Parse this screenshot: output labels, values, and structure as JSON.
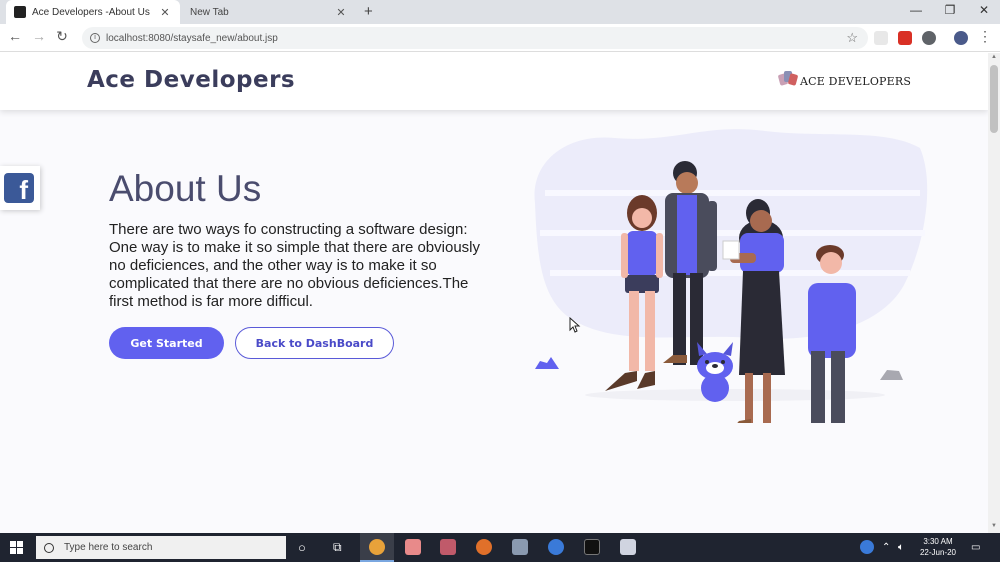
{
  "browser": {
    "tabs": [
      {
        "label": "Ace Developers -About Us",
        "active": true
      },
      {
        "label": "New Tab",
        "active": false
      }
    ],
    "address": "localhost:8080/staysafe_new/about.jsp"
  },
  "site": {
    "brand": "Ace Developers",
    "logo_text": "ACE DEVELOPERS",
    "title": "About Us",
    "description": "There are two ways fo constructing a software design: One way is to make it so simple that there are obviously no deficiences, and the other way is to make it so complicated that there are no obvious deficiences.The first method is far more difficul.",
    "buttons": {
      "primary": "Get Started",
      "secondary": "Back to DashBoard"
    },
    "social": "f"
  },
  "colors": {
    "accent": "#6161ef",
    "brand_text": "#3b3d5c",
    "facebook": "#3b5998"
  },
  "taskbar": {
    "search_placeholder": "Type here to search",
    "time": "3:30 AM",
    "date": "22-Jun-20"
  }
}
